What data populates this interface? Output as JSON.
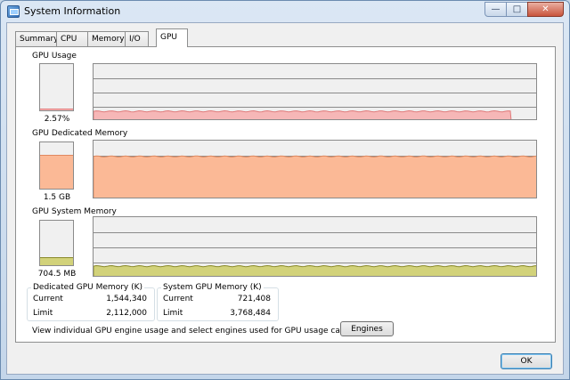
{
  "window": {
    "title": "System Information"
  },
  "titlebar_buttons": {
    "minimize": "—",
    "maximize": "□",
    "close": "✕"
  },
  "tabs": [
    {
      "label": "Summary",
      "active": false
    },
    {
      "label": "CPU",
      "active": false
    },
    {
      "label": "Memory",
      "active": false
    },
    {
      "label": "I/O",
      "active": false
    },
    {
      "label": "GPU",
      "active": true
    }
  ],
  "gpu_usage": {
    "label": "GPU Usage",
    "value_text": "2.57%",
    "fill_fraction": 0.03
  },
  "gpu_dedicated": {
    "label": "GPU Dedicated Memory",
    "value_text": "1.5 GB",
    "fill_fraction": 0.73
  },
  "gpu_system": {
    "label": "GPU System Memory",
    "value_text": "704.5 MB",
    "fill_fraction": 0.19
  },
  "colors": {
    "usage_line": "#e07a7a",
    "usage_fill": "#f6b7b7",
    "dedicated_line": "#e0895f",
    "dedicated_fill": "#fbb996",
    "system_line": "#8a8a2a",
    "system_fill": "#d2d27a",
    "grid": "#8a8a8a"
  },
  "dedicated_box": {
    "title": "Dedicated GPU Memory (K)",
    "current_label": "Current",
    "current_value": "1,544,340",
    "limit_label": "Limit",
    "limit_value": "2,112,000"
  },
  "system_box": {
    "title": "System GPU Memory (K)",
    "current_label": "Current",
    "current_value": "721,408",
    "limit_label": "Limit",
    "limit_value": "3,768,484"
  },
  "engines": {
    "description": "View individual GPU engine usage and select engines used for GPU usage calculations:",
    "button_label": "Engines"
  },
  "footer": {
    "ok_label": "OK"
  }
}
